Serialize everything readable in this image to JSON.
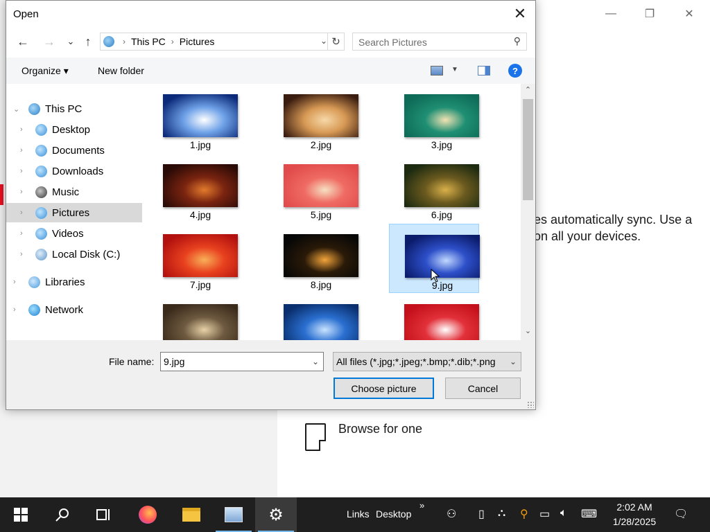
{
  "dialog": {
    "title": "Open",
    "close_glyph": "✕",
    "nav": {
      "back_glyph": "←",
      "forward_glyph": "→",
      "recent_glyph": "⌄",
      "up_glyph": "↑"
    },
    "breadcrumb": [
      "This PC",
      "Pictures"
    ],
    "breadcrumb_sep": "›",
    "search_placeholder": "Search Pictures",
    "toolbar": {
      "organize_label": "Organize ▾",
      "new_folder_label": "New folder",
      "help_glyph": "?"
    },
    "tree": [
      {
        "label": "This PC",
        "expanded": true,
        "level": 0
      },
      {
        "label": "Desktop",
        "level": 1
      },
      {
        "label": "Documents",
        "level": 1
      },
      {
        "label": "Downloads",
        "level": 1
      },
      {
        "label": "Music",
        "level": 1
      },
      {
        "label": "Pictures",
        "level": 1,
        "selected": true
      },
      {
        "label": "Videos",
        "level": 1
      },
      {
        "label": "Local Disk (C:)",
        "level": 1
      },
      {
        "label": "Libraries",
        "level": 0
      },
      {
        "label": "Network",
        "level": 0
      }
    ],
    "files": [
      {
        "name": "1.jpg",
        "colors": [
          "#0c2a7a",
          "#6fa2e8",
          "#ffffff"
        ]
      },
      {
        "name": "2.jpg",
        "colors": [
          "#3a1c10",
          "#d89a55",
          "#f6d8a8"
        ]
      },
      {
        "name": "3.jpg",
        "colors": [
          "#0e6b57",
          "#1f8f73",
          "#f2e3b3"
        ]
      },
      {
        "name": "4.jpg",
        "colors": [
          "#2a0a06",
          "#7a2410",
          "#e27a2c"
        ]
      },
      {
        "name": "5.jpg",
        "colors": [
          "#e14b4b",
          "#ef6b63",
          "#f6e0c2"
        ]
      },
      {
        "name": "6.jpg",
        "colors": [
          "#1c2a10",
          "#6b5a1f",
          "#d9b04a"
        ]
      },
      {
        "name": "7.jpg",
        "colors": [
          "#b3110f",
          "#e8411f",
          "#f8b058"
        ]
      },
      {
        "name": "8.jpg",
        "colors": [
          "#070707",
          "#2a1a08",
          "#f3a43a"
        ]
      },
      {
        "name": "9.jpg",
        "colors": [
          "#0b1c6b",
          "#2d4fc9",
          "#c1d8ff"
        ],
        "selected": true
      },
      {
        "name": "",
        "colors": [
          "#3a2a1a",
          "#6e5a40",
          "#e8d2a8"
        ]
      },
      {
        "name": "",
        "colors": [
          "#0a2f6e",
          "#2a6fd0",
          "#c9e3ff"
        ]
      },
      {
        "name": "",
        "colors": [
          "#c4101a",
          "#e2313a",
          "#ffffff"
        ]
      }
    ],
    "file_name_label": "File name:",
    "file_name_value": "9.jpg",
    "filter_value": "All files (*.jpg;*.jpeg;*.bmp;*.dib;*.png",
    "choose_label": "Choose picture",
    "cancel_label": "Cancel"
  },
  "background": {
    "sync_text_line1": "es automatically sync. Use a",
    "sync_text_line2": "on all your devices.",
    "browse_label": "Browse for one"
  },
  "taskbar": {
    "links_label": "Links",
    "desktop_label": "Desktop",
    "more_glyph": "»",
    "time": "2:02 AM",
    "date": "1/28/2025"
  },
  "colors": {
    "accent": "#0078d7",
    "selection": "#cce8ff",
    "taskbar": "#1f1f1f"
  }
}
